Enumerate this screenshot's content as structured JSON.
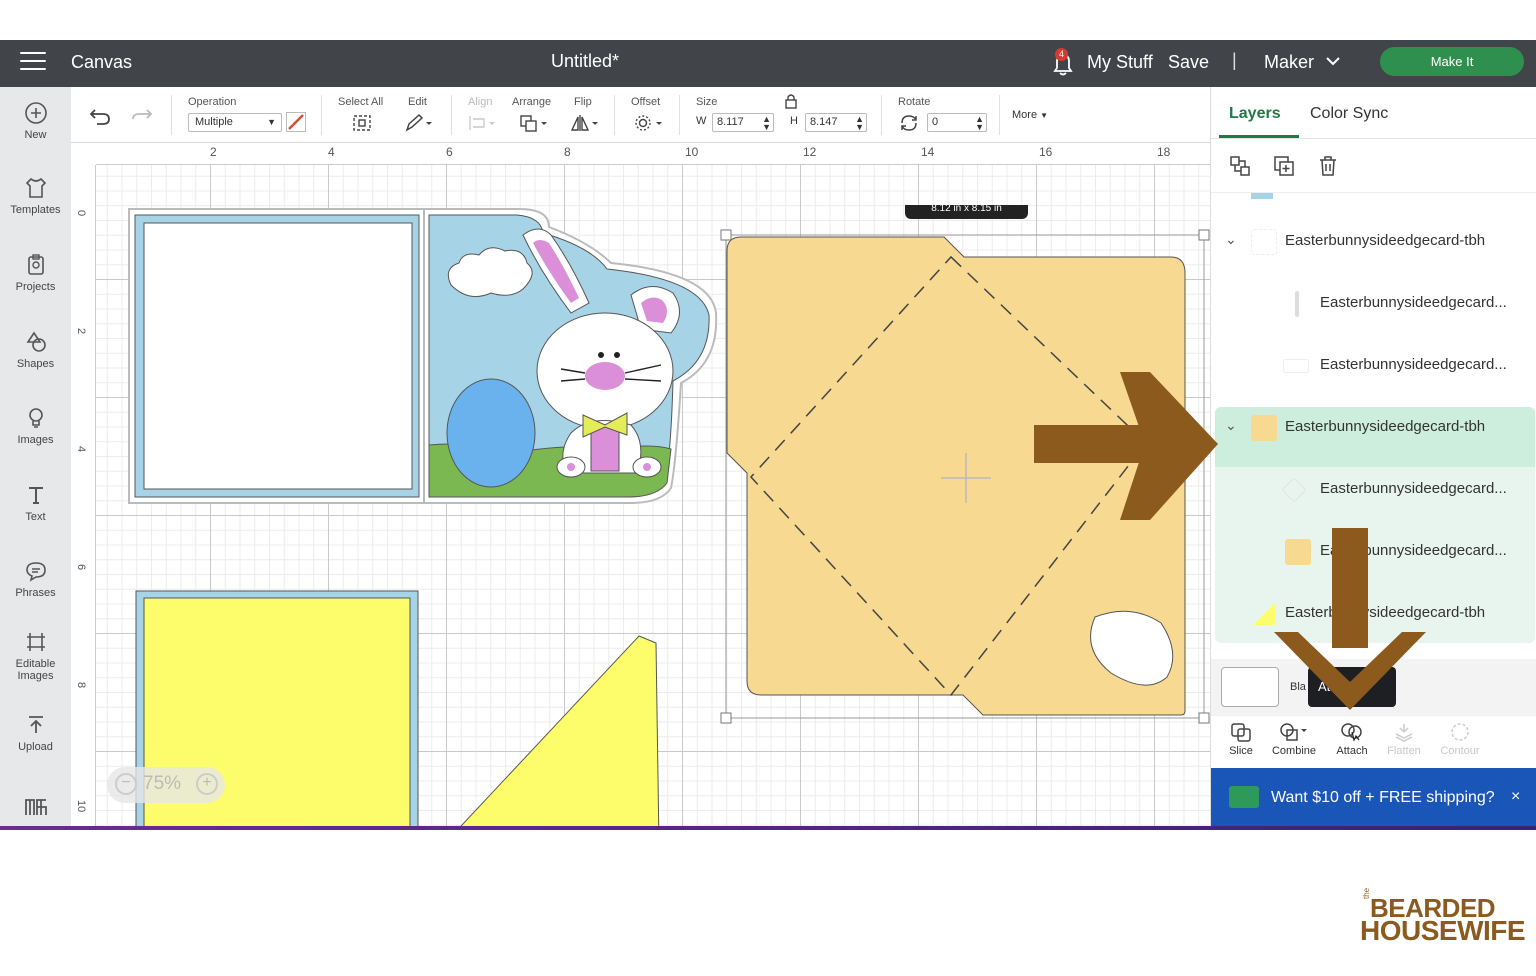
{
  "topbar": {
    "app_title": "Canvas",
    "doc_title": "Untitled*",
    "notification_count": "4",
    "my_stuff": "My Stuff",
    "save": "Save",
    "separator": "|",
    "machine": "Maker",
    "make_it": "Make It"
  },
  "sidebar": {
    "items": [
      {
        "label": "New",
        "icon": "plus-circle-icon"
      },
      {
        "label": "Templates",
        "icon": "shirt-icon"
      },
      {
        "label": "Projects",
        "icon": "clipboard-icon"
      },
      {
        "label": "Shapes",
        "icon": "shapes-icon"
      },
      {
        "label": "Images",
        "icon": "bulb-icon"
      },
      {
        "label": "Text",
        "icon": "text-icon"
      },
      {
        "label": "Phrases",
        "icon": "speech-bubble-icon"
      },
      {
        "label": "Editable Images",
        "icon": "editable-image-icon"
      },
      {
        "label": "Upload",
        "icon": "upload-icon"
      },
      {
        "label": "",
        "icon": "monogram-icon"
      }
    ]
  },
  "toolbar": {
    "operation_label": "Operation",
    "operation_value": "Multiple",
    "select_all_label": "Select All",
    "edit_label": "Edit",
    "align_label": "Align",
    "arrange_label": "Arrange",
    "flip_label": "Flip",
    "offset_label": "Offset",
    "size_label": "Size",
    "w_label": "W",
    "w_value": "8.117",
    "h_label": "H",
    "h_value": "8.147",
    "rotate_label": "Rotate",
    "rotate_value": "0",
    "more_label": "More"
  },
  "canvas": {
    "ruler_h": [
      "2",
      "4",
      "6",
      "8",
      "10",
      "12",
      "14",
      "16",
      "18"
    ],
    "ruler_v": [
      "0",
      "2",
      "4",
      "6",
      "8",
      "10"
    ],
    "zoom_value": "75%",
    "zoom_minus": "−",
    "zoom_plus": "+",
    "dimension_tip": "8.12 in x 8.15 in"
  },
  "panel": {
    "tab_layers": "Layers",
    "tab_color_sync": "Color Sync",
    "layers": [
      {
        "label": "Easterbunnysideedgecard-tbh",
        "level": 0,
        "expanded": true
      },
      {
        "label": "Easterbunnysideedgecard...",
        "level": 1
      },
      {
        "label": "Easterbunnysideedgecard...",
        "level": 1
      },
      {
        "label": "Easterbunnysideedgecard-tbh",
        "level": 0,
        "expanded": true,
        "selected": true
      },
      {
        "label": "Easterbunnysideedgecard...",
        "level": 1
      },
      {
        "label": "Easterbunnysideedgecard...",
        "level": 1
      },
      {
        "label": "Easterbunnysideedgecard-tbh",
        "level": 0
      }
    ],
    "blank_canvas_label": "Bla",
    "tooltip_text": "Attach",
    "tools": [
      {
        "label": "Slice",
        "enabled": true
      },
      {
        "label": "Combine",
        "enabled": true
      },
      {
        "label": "Attach",
        "enabled": true
      },
      {
        "label": "Flatten",
        "enabled": false
      },
      {
        "label": "Contour",
        "enabled": false
      }
    ],
    "promo_text": "Want $10 off + FREE shipping?",
    "promo_close": "×"
  },
  "watermark": {
    "line1": "BEARDED",
    "line2": "HOUSEWIFE",
    "small": "the"
  },
  "colors": {
    "topbar": "#414549",
    "accent_green": "#2f8f4e",
    "envelope": "#f7d991",
    "card_blue": "#a7d3e6",
    "yellow": "#fdfd6c",
    "arrow_brown": "#8b5a1c",
    "promo_blue": "#1a56b8"
  }
}
